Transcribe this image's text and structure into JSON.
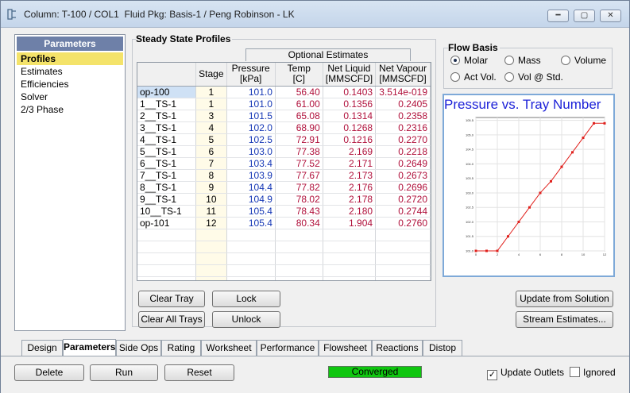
{
  "window": {
    "title": "Column: T-100 / COL1  Fluid Pkg: Basis-1 / Peng Robinson - LK",
    "minimize": "━",
    "maximize": "▢",
    "close": "✕"
  },
  "nav": {
    "header": "Parameters",
    "items": [
      "Profiles",
      "Estimates",
      "Efficiencies",
      "Solver",
      "2/3 Phase"
    ]
  },
  "profiles": {
    "group_title": "Steady State Profiles",
    "optional_header": "Optional Estimates",
    "columns": [
      {
        "l1": "",
        "l2": ""
      },
      {
        "l1": "Stage",
        "l2": ""
      },
      {
        "l1": "Pressure",
        "l2": "[kPa]"
      },
      {
        "l1": "Temp",
        "l2": "[C]"
      },
      {
        "l1": "Net Liquid",
        "l2": "[MMSCFD]"
      },
      {
        "l1": "Net Vapour",
        "l2": "[MMSCFD]"
      }
    ],
    "rows": [
      {
        "name": "op-100",
        "stage": "1",
        "pressure": "101.0",
        "temp": "56.40",
        "liquid": "0.1403",
        "vapour": "3.514e-019"
      },
      {
        "name": "1__TS-1",
        "stage": "1",
        "pressure": "101.0",
        "temp": "61.00",
        "liquid": "0.1356",
        "vapour": "0.2405"
      },
      {
        "name": "2__TS-1",
        "stage": "3",
        "pressure": "101.5",
        "temp": "65.08",
        "liquid": "0.1314",
        "vapour": "0.2358"
      },
      {
        "name": "3__TS-1",
        "stage": "4",
        "pressure": "102.0",
        "temp": "68.90",
        "liquid": "0.1268",
        "vapour": "0.2316"
      },
      {
        "name": "4__TS-1",
        "stage": "5",
        "pressure": "102.5",
        "temp": "72.91",
        "liquid": "0.1216",
        "vapour": "0.2270"
      },
      {
        "name": "5__TS-1",
        "stage": "6",
        "pressure": "103.0",
        "temp": "77.38",
        "liquid": "2.169",
        "vapour": "0.2218"
      },
      {
        "name": "6__TS-1",
        "stage": "7",
        "pressure": "103.4",
        "temp": "77.52",
        "liquid": "2.171",
        "vapour": "0.2649"
      },
      {
        "name": "7__TS-1",
        "stage": "8",
        "pressure": "103.9",
        "temp": "77.67",
        "liquid": "2.173",
        "vapour": "0.2673"
      },
      {
        "name": "8__TS-1",
        "stage": "9",
        "pressure": "104.4",
        "temp": "77.82",
        "liquid": "2.176",
        "vapour": "0.2696"
      },
      {
        "name": "9__TS-1",
        "stage": "10",
        "pressure": "104.9",
        "temp": "78.02",
        "liquid": "2.178",
        "vapour": "0.2720"
      },
      {
        "name": "10__TS-1",
        "stage": "11",
        "pressure": "105.4",
        "temp": "78.43",
        "liquid": "2.180",
        "vapour": "0.2744"
      },
      {
        "name": "op-101",
        "stage": "12",
        "pressure": "105.4",
        "temp": "80.34",
        "liquid": "1.904",
        "vapour": "0.2760"
      }
    ],
    "empty_rows": 5
  },
  "buttons": {
    "clear_tray": "Clear Tray",
    "lock": "Lock",
    "clear_all_trays": "Clear All Trays",
    "unlock": "Unlock",
    "update_from_solution": "Update from Solution",
    "stream_estimates": "Stream Estimates...",
    "delete": "Delete",
    "run": "Run",
    "reset": "Reset"
  },
  "flow_basis": {
    "title": "Flow Basis",
    "options": [
      "Molar",
      "Mass",
      "Volume",
      "Act Vol.",
      "Vol @ Std."
    ],
    "selected": "Molar"
  },
  "tabs": [
    "Design",
    "Parameters",
    "Side Ops",
    "Rating",
    "Worksheet",
    "Performance",
    "Flowsheet",
    "Reactions",
    "Distop"
  ],
  "active_tab": "Parameters",
  "status": "Converged",
  "status_color": "#0fc60f",
  "update_outlets": {
    "label": "Update Outlets",
    "checked": true
  },
  "ignored": {
    "label": "Ignored",
    "checked": false
  },
  "chart_data": {
    "type": "line",
    "title": "Pressure vs. Tray Number",
    "xlabel": "",
    "ylabel": "",
    "x": [
      0,
      1,
      2,
      3,
      4,
      5,
      6,
      7,
      8,
      9,
      10,
      11,
      12
    ],
    "y": [
      101.0,
      101.0,
      101.0,
      101.5,
      102.0,
      102.5,
      103.0,
      103.4,
      103.9,
      104.4,
      104.9,
      105.4,
      105.4
    ],
    "xlim": [
      0,
      12
    ],
    "ylim": [
      101.0,
      105.6
    ],
    "xticks": [
      "0",
      "2",
      "4",
      "6",
      "8",
      "10",
      "12"
    ],
    "yticks": [
      "101.0",
      "101.5",
      "102.0",
      "102.5",
      "103.0",
      "103.5",
      "104.0",
      "104.5",
      "105.0",
      "105.5"
    ],
    "grid": true,
    "color": "#e0201c"
  }
}
